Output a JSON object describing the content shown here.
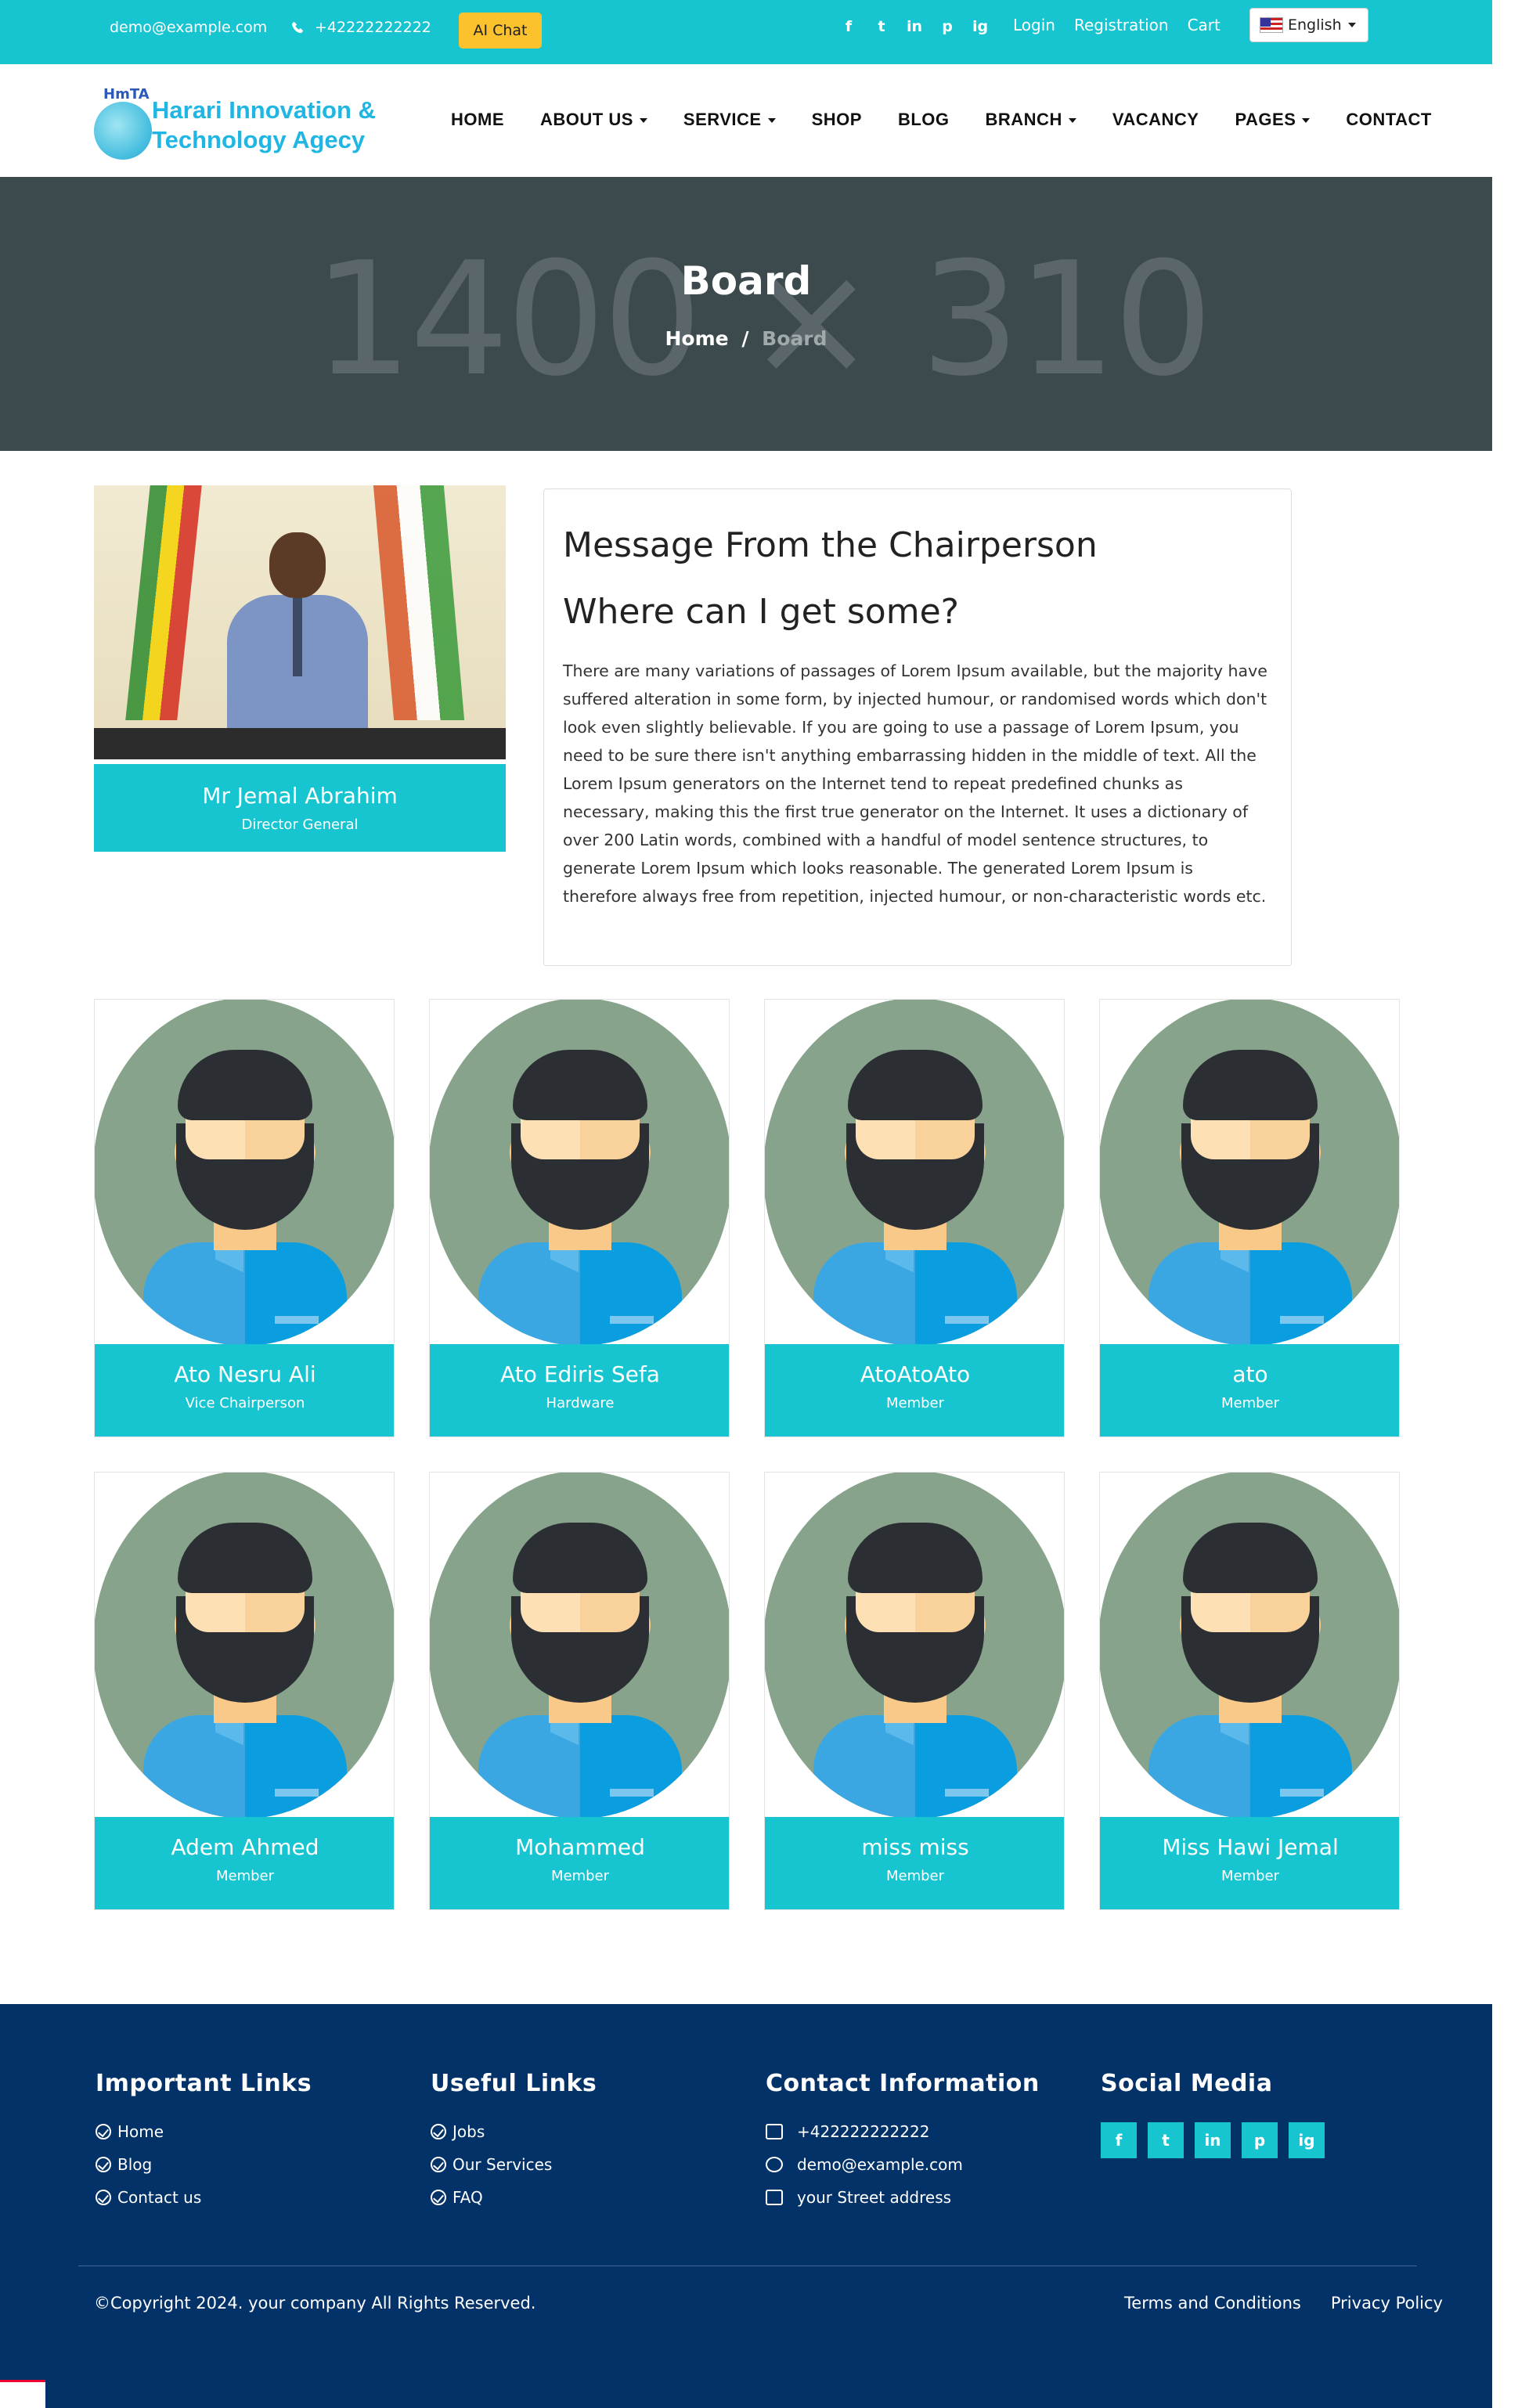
{
  "topbar": {
    "email": "demo@example.com",
    "phone": "+42222222222",
    "ai_chat": "AI Chat",
    "social": [
      "f",
      "t",
      "in",
      "p",
      "ig"
    ],
    "links": [
      "Login",
      "Registration",
      "Cart"
    ],
    "language": "English"
  },
  "header": {
    "logo_abbr": "HmTA",
    "logo_line1": "Harari Innovation &",
    "logo_line2": "Technology Agecy",
    "nav": [
      "HOME",
      "ABOUT US",
      "SERVICE",
      "SHOP",
      "BLOG",
      "BRANCH",
      "VACANCY",
      "PAGES",
      "CONTACT"
    ]
  },
  "banner": {
    "placeholder": "1400 × 310",
    "title": "Board",
    "crumb_home": "Home",
    "crumb_sep": "/",
    "crumb_current": "Board"
  },
  "chairperson": {
    "name": "Mr Jemal Abrahim",
    "role": "Director General",
    "heading": "Message From the Chairperson",
    "subheading": "Where can I get some?",
    "message": "There are many variations of passages of Lorem Ipsum available, but the majority have suffered alteration in some form, by injected humour, or randomised words which don't look even slightly believable. If you are going to use a passage of Lorem Ipsum, you need to be sure there isn't anything embarrassing hidden in the middle of text. All the Lorem Ipsum generators on the Internet tend to repeat predefined chunks as necessary, making this the first true generator on the Internet. It uses a dictionary of over 200 Latin words, combined with a handful of model sentence structures, to generate Lorem Ipsum which looks reasonable. The generated Lorem Ipsum is therefore always free from repetition, injected humour, or non-characteristic words etc."
  },
  "members": [
    {
      "name": "Ato Nesru Ali",
      "role": "Vice Chairperson"
    },
    {
      "name": "Ato Ediris Sefa",
      "role": "Hardware"
    },
    {
      "name": "AtoAtoAto",
      "role": "Member"
    },
    {
      "name": "ato",
      "role": "Member"
    },
    {
      "name": "Adem Ahmed",
      "role": "Member"
    },
    {
      "name": "Mohammed",
      "role": "Member"
    },
    {
      "name": "miss miss",
      "role": "Member"
    },
    {
      "name": "Miss Hawi Jemal",
      "role": "Member"
    }
  ],
  "footer": {
    "important_title": "Important Links",
    "important_links": [
      "Home",
      "Blog",
      "Contact us"
    ],
    "useful_title": "Useful Links",
    "useful_links": [
      "Jobs",
      "Our Services",
      "FAQ"
    ],
    "contact_title": "Contact Information",
    "contact": [
      "+422222222222",
      "demo@example.com",
      "your Street address"
    ],
    "social_title": "Social Media",
    "social": [
      "f",
      "t",
      "in",
      "p",
      "ig"
    ],
    "copyright": "©Copyright 2024. your company All Rights Reserved.",
    "terms": "Terms and Conditions",
    "privacy": "Privacy Policy"
  },
  "colors": {
    "accent": "#17c5d1",
    "footer_bg": "#023268",
    "banner_bg": "#3d4a4d",
    "ai_button": "#fcc22d"
  }
}
